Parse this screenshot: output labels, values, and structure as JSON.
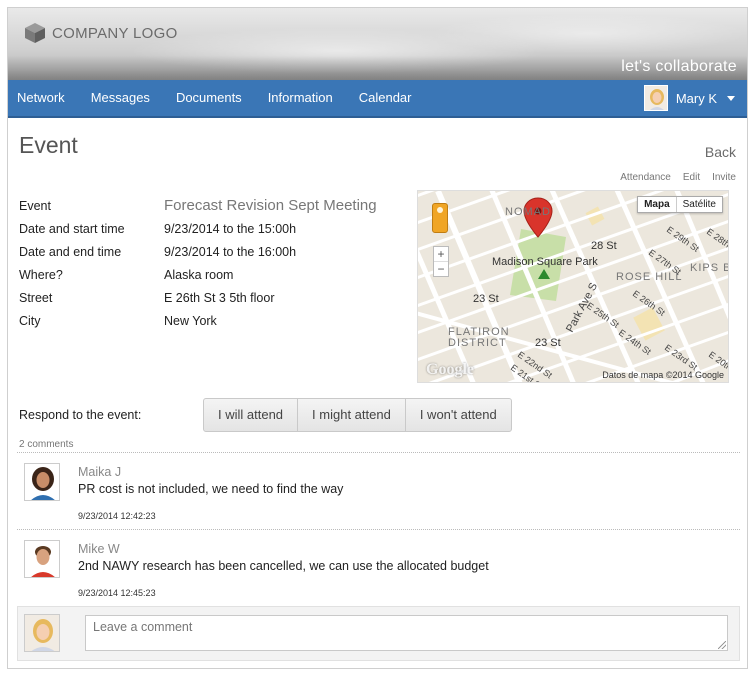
{
  "header": {
    "logo_text": "COMPANY LOGO",
    "tagline": "let's collaborate"
  },
  "nav": {
    "items": [
      {
        "label": "Network"
      },
      {
        "label": "Messages"
      },
      {
        "label": "Documents"
      },
      {
        "label": "Information"
      },
      {
        "label": "Calendar"
      }
    ],
    "user": {
      "name": "Mary K"
    }
  },
  "page": {
    "title": "Event",
    "back_label": "Back",
    "actions": [
      "Attendance",
      "Edit",
      "Invite"
    ]
  },
  "event": {
    "fields": [
      {
        "label": "Event",
        "value": "Forecast Revision Sept Meeting"
      },
      {
        "label": "Date and start time",
        "value": "9/23/2014 to the 15:00h"
      },
      {
        "label": "Date and end time",
        "value": "9/23/2014 to the 16:00h"
      },
      {
        "label": "Where?",
        "value": "Alaska room"
      },
      {
        "label": "Street",
        "value": "E 26th St 3 5th floor"
      },
      {
        "label": "City",
        "value": "New York"
      }
    ]
  },
  "map": {
    "toggle_map": "Mapa",
    "toggle_satellite": "Satélite",
    "zoom_in": "+",
    "zoom_out": "−",
    "attribution": "Datos de mapa ©2014 Google",
    "google": "Google",
    "labels": {
      "park": "Madison Square Park",
      "nomad": "NOMAD",
      "st28": "28 St",
      "st23a": "23 St",
      "st23b": "23 St",
      "flatiron1": "FLATIRON",
      "flatiron2": "DISTRICT",
      "rosehill": "ROSE HILL",
      "kips": "KIPS B",
      "e29": "E 29th St",
      "e28": "E 28th St",
      "e27": "E 27th St",
      "e26": "E 26th St",
      "e25": "E 25th St",
      "e24": "E 24th St",
      "e23": "E 23rd St",
      "e22": "E 22nd St",
      "e21": "E 21st St",
      "e20": "E 20th St",
      "parkave": "Park Ave S"
    }
  },
  "respond": {
    "label": "Respond to the event:",
    "buttons": [
      "I will attend",
      "I might attend",
      "I won't attend"
    ]
  },
  "comments": {
    "count_label": "2 comments",
    "items": [
      {
        "author": "Maika J",
        "text": "PR cost is not included, we need to find the way",
        "time": "9/23/2014 12:42:23"
      },
      {
        "author": "Mike W",
        "text": "2nd NAWY research has been cancelled, we can use the allocated budget",
        "time": "9/23/2014 12:45:23"
      }
    ],
    "new_placeholder": "Leave a comment"
  },
  "colors": {
    "nav_bg": "#3a76b6",
    "park_green": "#c8dfa8",
    "pin_red": "#d9342b"
  }
}
